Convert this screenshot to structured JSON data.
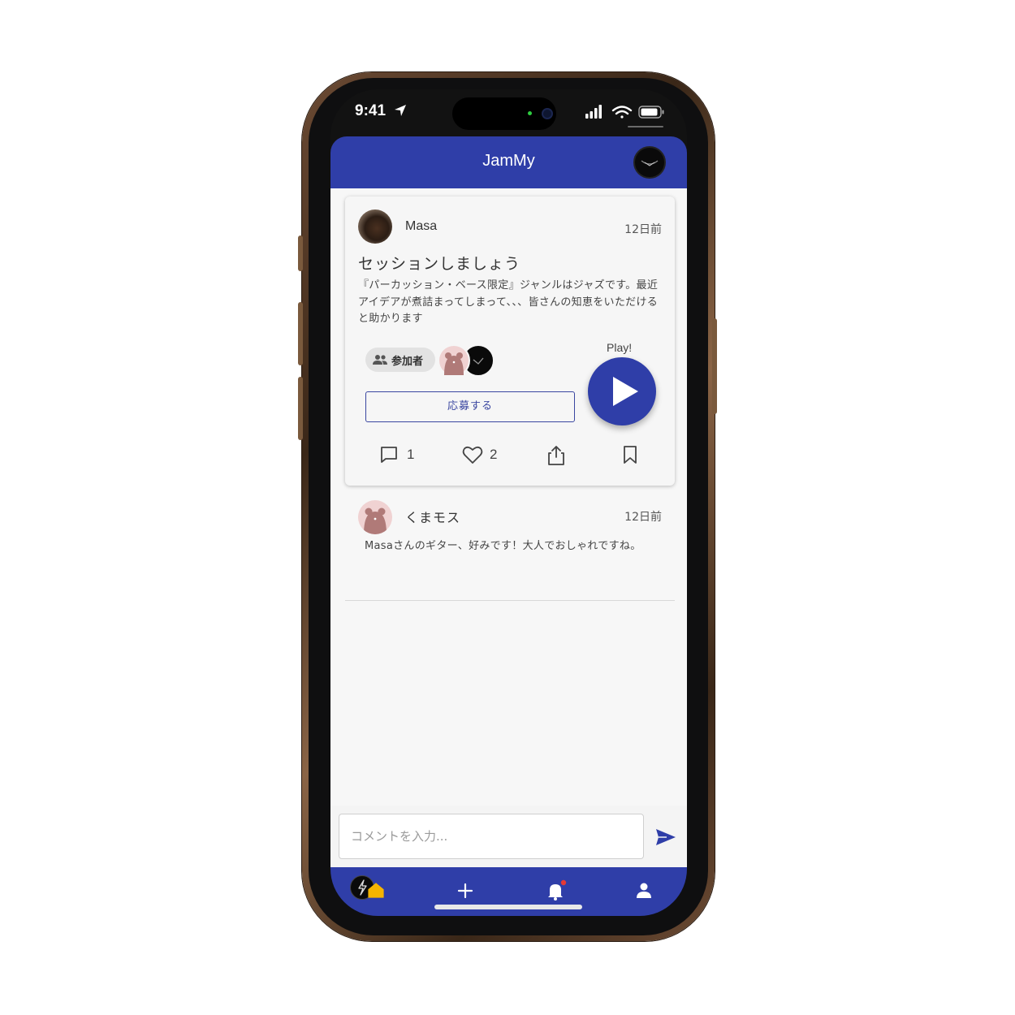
{
  "status_bar": {
    "time": "9:41"
  },
  "header": {
    "title": "JamMy"
  },
  "post": {
    "author": "Masa",
    "time_ago": "12日前",
    "title": "セッションしましょう",
    "body": "『パーカッション・ベース限定』ジャンルはジャズです。最近アイデアが煮詰まってしまって、、、皆さんの知恵をいただけると助かります",
    "participants_label": "参加者",
    "apply_label": "応募する",
    "play_label": "Play!",
    "comment_count": "1",
    "like_count": "2"
  },
  "comment": {
    "author": "くまモス",
    "time_ago": "12日前",
    "text": "Masaさんのギター、好みです！大人でおしゃれですね。"
  },
  "comment_input": {
    "placeholder": "コメントを入力..."
  },
  "colors": {
    "primary": "#2f3ea8",
    "accent": "#f5b400",
    "badge": "#e53935"
  },
  "icons": [
    "location-arrow-icon",
    "signal-icon",
    "wifi-icon",
    "battery-icon",
    "people-icon",
    "play-icon",
    "comment-icon",
    "heart-icon",
    "share-icon",
    "bookmark-icon",
    "send-icon",
    "home-icon",
    "plus-icon",
    "bell-icon",
    "user-icon"
  ]
}
